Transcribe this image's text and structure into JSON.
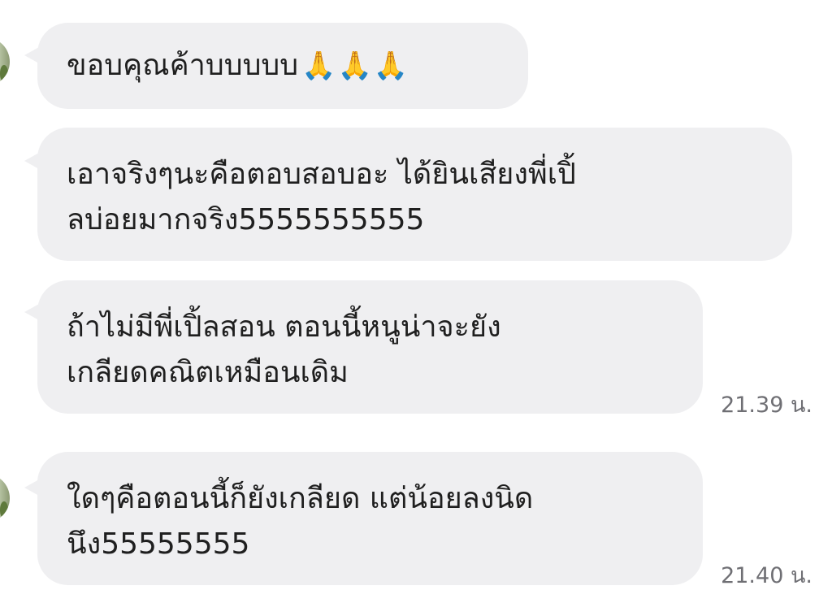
{
  "messages": [
    {
      "lines": [
        "ขอบคุณค้าบบบบบ"
      ],
      "emoji": "🙏🙏🙏",
      "emoji_name": "folded-hands-icon",
      "timestamp": ""
    },
    {
      "lines": [
        "เอาจริงๆนะคือตอบสอบอะ ได้ยินเสียงพี่เปิ้",
        "ลบ่อยมากจริง5555555555"
      ],
      "timestamp": ""
    },
    {
      "lines": [
        "ถ้าไม่มีพี่เปิ้ลสอน ตอนนี้หนูน่าจะยัง",
        "เกลียดคณิตเหมือนเดิม"
      ],
      "timestamp": "21.39 น."
    },
    {
      "lines": [
        "ใดๆคือตอนนี้ก็ยังเกลียด แต่น้อยลงนิด",
        "นึง55555555"
      ],
      "timestamp": "21.40 น."
    }
  ],
  "colors": {
    "bubble_bg": "#efeff1",
    "text": "#1f1f1f",
    "timestamp": "#6f6f74"
  }
}
